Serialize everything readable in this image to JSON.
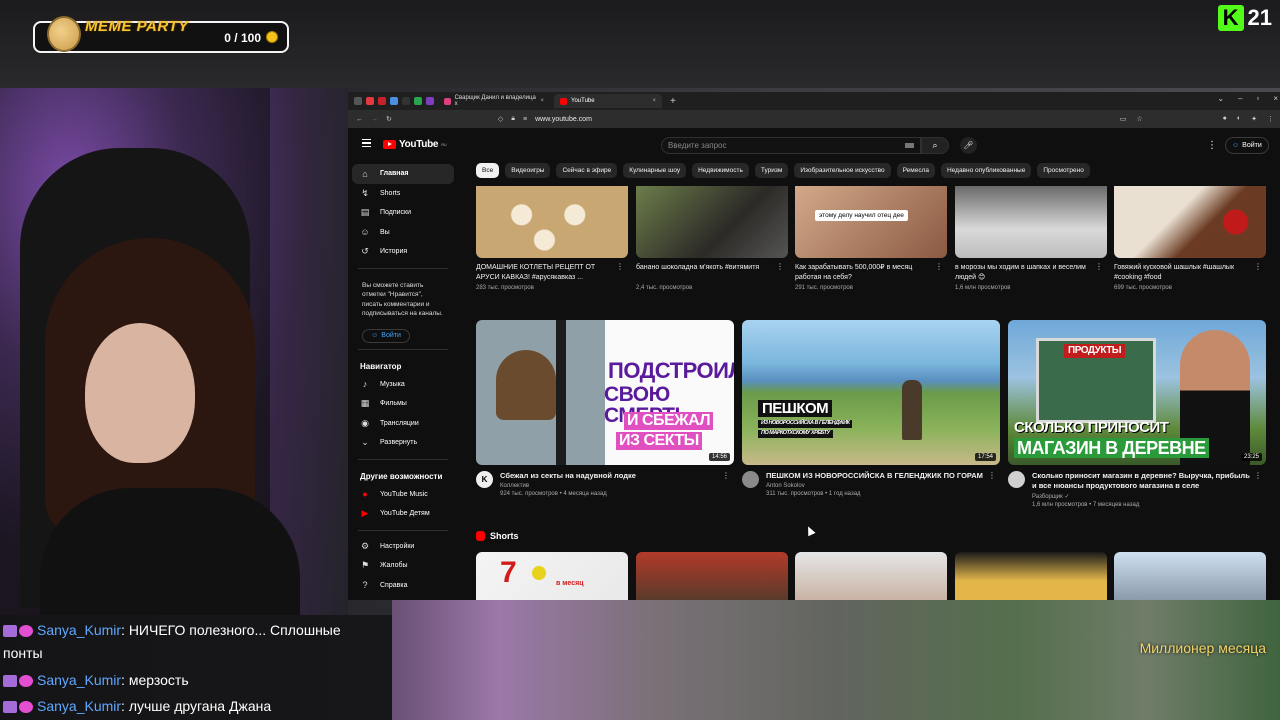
{
  "overlay": {
    "meme_party": {
      "title": "MEME PARTY",
      "count": "0 / 100"
    },
    "kick_counter": {
      "logo": "K",
      "number": "21"
    },
    "subscriber_label": "Миллионер месяца"
  },
  "browser": {
    "tabs": [
      {
        "label": "Сварщик Данил и владелица х",
        "close": "×"
      },
      {
        "label": "YouTube",
        "close": "×"
      }
    ],
    "new_tab": "+",
    "window_controls": [
      "⌄",
      "–",
      "▫",
      "×"
    ],
    "url": "www.youtube.com"
  },
  "youtube": {
    "logo_text": "YouTube",
    "logo_region": "RU",
    "search_placeholder": "Введите запрос",
    "signin_label": "Войти",
    "sidebar": {
      "main": [
        {
          "label": "Главная",
          "icon": "home-icon",
          "glyph": "⌂"
        },
        {
          "label": "Shorts",
          "icon": "shorts-icon",
          "glyph": "↯"
        },
        {
          "label": "Подписки",
          "icon": "subscriptions-icon",
          "glyph": "▤"
        },
        {
          "label": "Вы",
          "icon": "user-icon",
          "glyph": "☺"
        },
        {
          "label": "История",
          "icon": "history-icon",
          "glyph": "↺"
        }
      ],
      "promo_text": "Вы сможете ставить отметки \"Нравится\", писать комментарии и подписываться на каналы.",
      "promo_button": "Войти",
      "navigator_title": "Навигатор",
      "navigator": [
        {
          "label": "Музыка",
          "icon": "music-icon",
          "glyph": "♪"
        },
        {
          "label": "Фильмы",
          "icon": "film-icon",
          "glyph": "▦"
        },
        {
          "label": "Трансляции",
          "icon": "live-icon",
          "glyph": "◉"
        },
        {
          "label": "Развернуть",
          "icon": "chevron-down-icon",
          "glyph": "⌄"
        }
      ],
      "more_title": "Другие возможности",
      "more": [
        {
          "label": "YouTube Music",
          "icon": "youtube-music-icon",
          "glyph": "●"
        },
        {
          "label": "YouTube Детям",
          "icon": "youtube-kids-icon",
          "glyph": "▶"
        }
      ],
      "bottom": [
        {
          "label": "Настройки",
          "icon": "settings-icon",
          "glyph": "⚙"
        },
        {
          "label": "Жалобы",
          "icon": "flag-icon",
          "glyph": "⚑"
        },
        {
          "label": "Справка",
          "icon": "help-icon",
          "glyph": "?"
        }
      ]
    },
    "chips": [
      "Все",
      "Видеоигры",
      "Сейчас в эфире",
      "Кулинарные шоу",
      "Недвижимость",
      "Туризм",
      "Изобразительное искусство",
      "Ремесла",
      "Недавно опубликованные",
      "Просмотрено"
    ],
    "row1": [
      {
        "title": "ДОМАШНИЕ КОТЛЕТЫ РЕЦЕПТ ОТ АРУСИ КАВКАЗ! #арусякавказ ...",
        "meta": "283 тыс. просмотров",
        "color": "#d8c09a"
      },
      {
        "title": "банано шоколадна м'якоть #витямитя",
        "meta": "2,4 тыс. просмотров",
        "color": "#4b5a3a"
      },
      {
        "title": "Как зарабатывать 500,000₽ в месяц работая на себя?",
        "meta": "291 тыс. просмотров",
        "color": "#b98d6b",
        "caption": "этому делу научил отец дее"
      },
      {
        "title": "в морозы мы ходим в шапках и веселим людей 😊",
        "meta": "1,6 млн просмотров",
        "color": "#8a8a8a"
      },
      {
        "title": "Говяжий кусковой шашлык #шашлык #cooking #food",
        "meta": "699 тыс. просмотров",
        "color": "#6a3a24"
      }
    ],
    "row2": [
      {
        "title": "Сбежал из секты на надувной лодке",
        "channel": "Коллектив",
        "meta": "924 тыс. просмотров • 4 месяца назад",
        "duration": "14:56",
        "avatar": "K",
        "thumb_lines": [
          "ПОДСТРОИЛ",
          "СВОЮ СМЕРТЬ",
          "И СБЕЖАЛ",
          "ИЗ СЕКТЫ"
        ]
      },
      {
        "title": "ПЕШКОМ ИЗ НОВОРОССИЙСКА В ГЕЛЕНДЖИК ПО ГОРАМ",
        "channel": "Anton Sokolov",
        "meta": "311 тыс. просмотров • 1 год назад",
        "duration": "17:54",
        "avatar": "",
        "thumb_lines": [
          "ПЕШКОМ",
          "ИЗ НОВОРОССИЙСКА В ГЕЛЕНДЖИК",
          "ПО МАРКОТХСКОМУ ХРЕБТУ"
        ]
      },
      {
        "title": "Сколько приносит магазин в деревне? Выручка, прибыль и все нюансы продуктового магазина в селе",
        "channel": "Разборщик ✓",
        "meta": "1,6 млн просмотров • 7 месяцев назад",
        "duration": "23:25",
        "avatar": "",
        "thumb_lines": [
          "ПРОДУКТЫ",
          "СКОЛЬКО ПРИНОСИТ",
          "МАГАЗИН В ДЕРЕВНЕ"
        ]
      }
    ],
    "shorts_title": "Shorts",
    "shorts_caption": "в месяц"
  },
  "chat": [
    {
      "user": "Sanya_Kumir",
      "text": ": НИЧЕГО полезного... Сплошные"
    },
    {
      "user": "",
      "text": "понты"
    },
    {
      "user": "Sanya_Kumir",
      "text": ": мерзость"
    },
    {
      "user": "Sanya_Kumir",
      "text": ": лучше другана Джана"
    }
  ],
  "colors": {
    "accent": "#3ea6ff",
    "brand_red": "#ff0000",
    "username": "#5fa8ff",
    "kick_green": "#53fc18"
  }
}
